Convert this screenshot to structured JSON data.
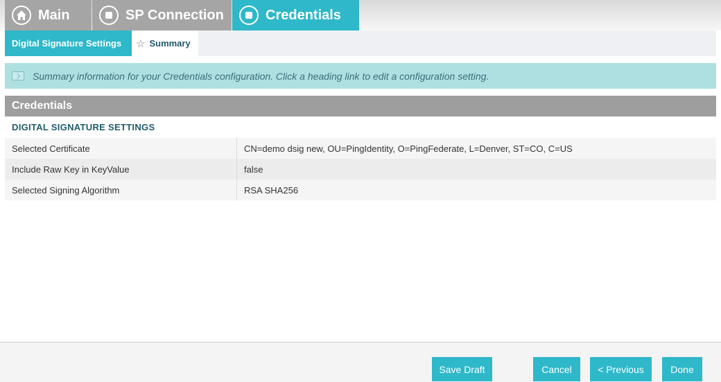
{
  "breadcrumbs": [
    {
      "label": "Main",
      "icon": "home-icon"
    },
    {
      "label": "SP Connection",
      "icon": "stop-icon"
    },
    {
      "label": "Credentials",
      "icon": "stop-icon"
    }
  ],
  "subtabs": [
    {
      "label": "Digital Signature Settings"
    },
    {
      "label": "Summary",
      "icon": "star-icon"
    }
  ],
  "banner": {
    "text": "Summary information for your Credentials configuration. Click a heading link to edit a configuration setting."
  },
  "section": {
    "title": "Credentials",
    "subheading": "DIGITAL SIGNATURE SETTINGS",
    "rows": [
      {
        "label": "Selected Certificate",
        "value": "CN=demo dsig new, OU=PingIdentity, O=PingFederate, L=Denver, ST=CO, C=US"
      },
      {
        "label": "Include Raw Key in KeyValue",
        "value": "false"
      },
      {
        "label": "Selected Signing Algorithm",
        "value": "RSA SHA256"
      }
    ]
  },
  "footer": {
    "save_draft": "Save Draft",
    "cancel": "Cancel",
    "previous": "< Previous",
    "done": "Done"
  },
  "colors": {
    "accent": "#2eb8c9",
    "inactive_tab": "#a5a5a5",
    "banner_bg": "#aee0e2",
    "section_header": "#9e9e9e"
  }
}
